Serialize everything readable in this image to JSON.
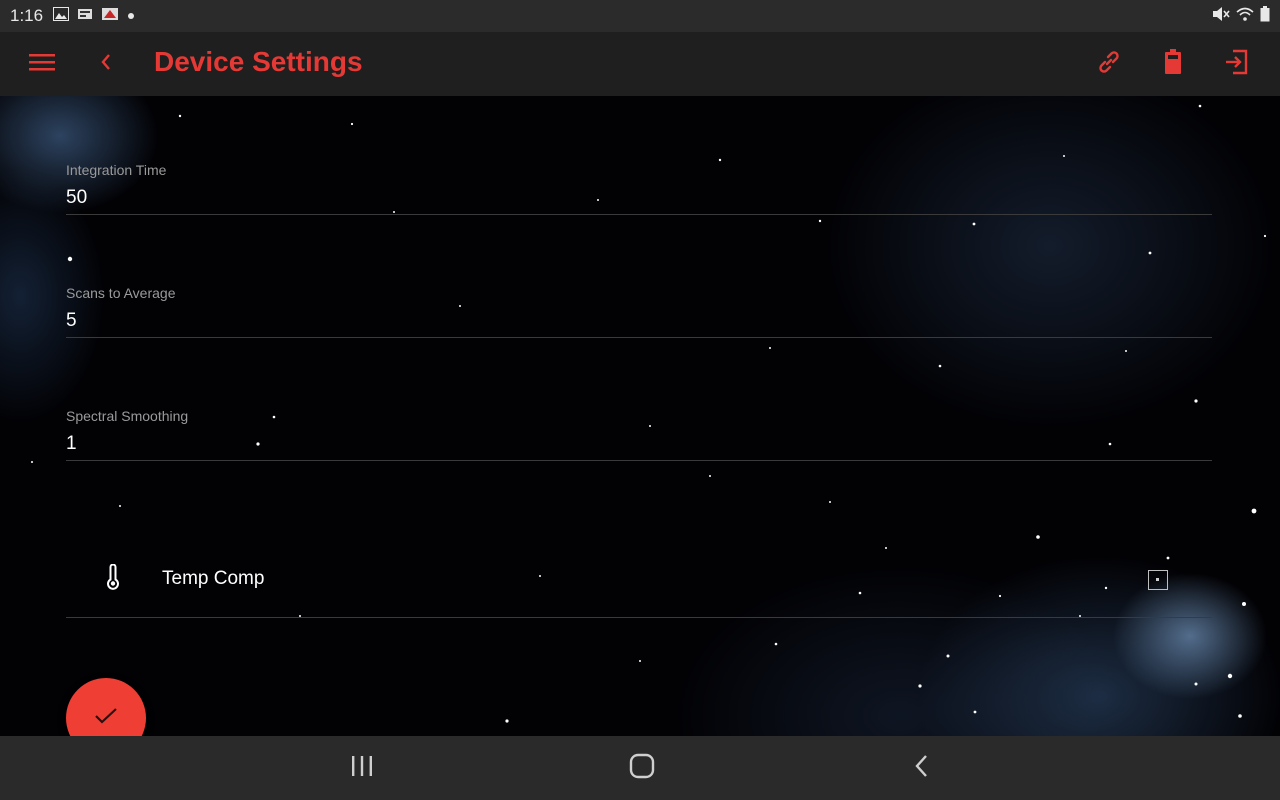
{
  "status_bar": {
    "time": "1:16",
    "left_icons": [
      "image-notification-icon",
      "app-notification-icon",
      "app-notification-icon-2",
      "dot-icon"
    ],
    "right_icons": [
      "mute-icon",
      "wifi-icon",
      "battery-icon"
    ]
  },
  "app_bar": {
    "title": "Device Settings",
    "accent_color": "#e53935",
    "icons": [
      "menu-icon",
      "back-arrow-icon",
      "link-icon",
      "battery-icon",
      "logout-icon"
    ]
  },
  "settings": {
    "integration_time": {
      "label": "Integration Time",
      "value": "50"
    },
    "scans_to_average": {
      "label": "Scans to Average",
      "value": "5"
    },
    "spectral_smoothing": {
      "label": "Spectral Smoothing",
      "value": "1"
    },
    "temp_comp": {
      "label": "Temp Comp",
      "icon": "thermometer-icon",
      "checked": false
    }
  },
  "fab": {
    "icon": "checkmark-icon",
    "color": "#ef3f34"
  },
  "nav_bar": {
    "icons": [
      "recents-icon",
      "home-icon",
      "back-icon"
    ]
  }
}
